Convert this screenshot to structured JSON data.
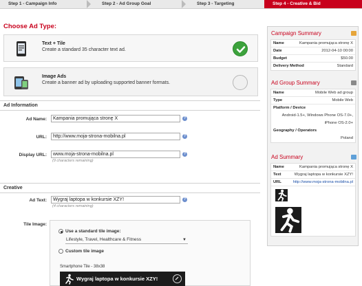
{
  "steps": [
    {
      "label": "Step 1 - Campaign Info",
      "active": false
    },
    {
      "label": "Step 2 - Ad Group Goal",
      "active": false
    },
    {
      "label": "Step 3 - Targeting",
      "active": false
    },
    {
      "label": "Step 4 - Creative & Bid",
      "active": true
    }
  ],
  "choose_ad_type": {
    "title": "Choose Ad Type:",
    "options": [
      {
        "title": "Text + Tile",
        "description": "Create a standard 35 character text ad.",
        "selected": true
      },
      {
        "title": "Image Ads",
        "description": "Create a banner ad by uploading supported banner formats.",
        "selected": false
      }
    ]
  },
  "ad_information": {
    "section_title": "Ad Information",
    "ad_name_label": "Ad Name:",
    "ad_name_value": "Kampania promująca stronę X",
    "url_label": "URL:",
    "url_value": "http://www.moja-strona-mobilna.pl",
    "display_url_label": "Display URL:",
    "display_url_value": "www.moja-strona-mobilna.pl",
    "display_url_hint": "(9 characters remaining)"
  },
  "creative": {
    "section_title": "Creative",
    "ad_text_label": "Ad Text:",
    "ad_text_value": "Wygraj laptopa w konkursie XZY!",
    "ad_text_hint": "(4 characters remaining)",
    "tile_image_label": "Tile Image:",
    "standard_tile_label": "Use a standard tile image:",
    "standard_tile_selected": true,
    "tile_category_value": "Lifestyle, Travel, Healthcare & Fitness",
    "custom_tile_label": "Custom tile image",
    "custom_tile_selected": false,
    "smartphone_tile_label": "Smartphone Tile - 38x38",
    "preview_text": "Wygraj laptopa w konkursie XZY!"
  },
  "campaign_summary": {
    "title": "Campaign Summary",
    "rows": [
      {
        "key": "Name",
        "value": "Kampania promująca stronę X"
      },
      {
        "key": "Date",
        "value": "2012-04-10 00:00"
      },
      {
        "key": "Budget",
        "value": "$50.00"
      },
      {
        "key": "Delivery Method",
        "value": "Standard"
      }
    ]
  },
  "ad_group_summary": {
    "title": "Ad Group Summary",
    "name_key": "Name",
    "name_value": "Mobile Web ad group",
    "type_key": "Type",
    "type_value": "Mobile Web",
    "platform_key": "Platform / Device",
    "platform_value_1": "Android-1.5+, Windows Phone OS-7.0+,",
    "platform_value_2": "iPhone OS-2.0+",
    "geo_key": "Geography / Operators",
    "geo_value": "Poland"
  },
  "ad_summary": {
    "title": "Ad Summary",
    "name_key": "Name",
    "name_value": "Kampania promująca stronę X",
    "text_key": "Text",
    "text_value": "Wygraj laptopa w konkursie XZY!",
    "url_key": "URL",
    "url_value": "http://www.moja-strona-mobilna.pl"
  },
  "colors": {
    "accent": "#c8001c",
    "check_green": "#3ca23c",
    "link_blue": "#1a4fa8"
  }
}
